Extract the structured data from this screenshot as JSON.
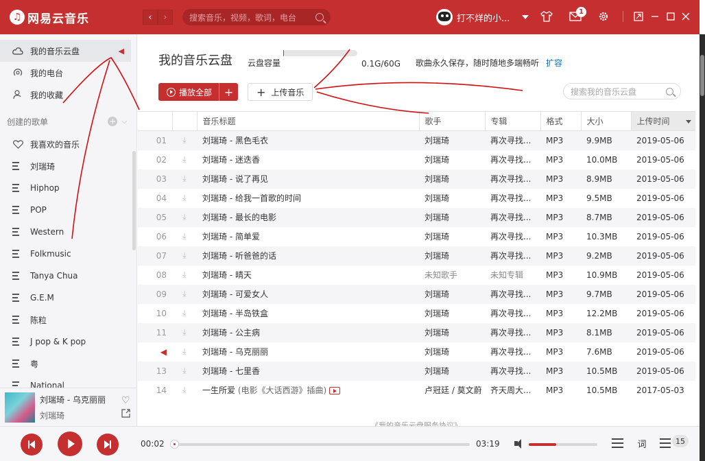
{
  "app": {
    "brand": "网易云音乐",
    "search_placeholder": "搜索音乐，视频，歌词，电台",
    "username": "打不烊的小...",
    "message_count": "1"
  },
  "sidebar": {
    "items": [
      {
        "label": "我的音乐云盘",
        "icon": "cloud-icon",
        "active": true
      },
      {
        "label": "我的电台",
        "icon": "radio-icon"
      },
      {
        "label": "我的收藏",
        "icon": "collection-icon"
      }
    ],
    "created_section": "创建的歌单",
    "playlists": [
      {
        "label": "我喜欢的音乐",
        "icon": "heart-icon"
      },
      {
        "label": "刘瑞琦",
        "icon": "playlist-icon"
      },
      {
        "label": "Hiphop",
        "icon": "playlist-icon"
      },
      {
        "label": "POP",
        "icon": "playlist-icon"
      },
      {
        "label": "Western",
        "icon": "playlist-icon"
      },
      {
        "label": "Folkmusic",
        "icon": "playlist-icon"
      },
      {
        "label": "Tanya Chua",
        "icon": "playlist-icon"
      },
      {
        "label": "G.E.M",
        "icon": "playlist-icon"
      },
      {
        "label": "陈粒",
        "icon": "playlist-icon"
      },
      {
        "label": "J pop & K pop",
        "icon": "playlist-icon"
      },
      {
        "label": "粤",
        "icon": "playlist-icon"
      },
      {
        "label": "National",
        "icon": "playlist-icon"
      }
    ]
  },
  "now_playing": {
    "title": "刘瑞琦 - 乌克丽丽",
    "artist": "刘瑞琦"
  },
  "cloud": {
    "title": "我的音乐云盘",
    "capacity_label": "云盘容量",
    "capacity_value": "0.1G/60G",
    "capacity_fraction": 0.002,
    "note": "歌曲永久保存，随时随地多端畅听",
    "expand_link": "扩容",
    "play_all": "播放全部",
    "upload": "上传音乐",
    "search_placeholder": "搜索我的音乐云盘",
    "footnote": "《我的音乐云盘服务协议》"
  },
  "table": {
    "columns": [
      "音乐标题",
      "歌手",
      "专辑",
      "格式",
      "大小",
      "上传时间"
    ],
    "rows": [
      {
        "idx": "01",
        "title": "刘瑞琦 - 黑色毛衣",
        "artist": "刘瑞琦",
        "album": "再次寻找...",
        "format": "MP3",
        "size": "9.9MB",
        "date": "2019-05-06"
      },
      {
        "idx": "02",
        "title": "刘瑞琦 - 迷迭香",
        "artist": "刘瑞琦",
        "album": "再次寻找...",
        "format": "MP3",
        "size": "10.0MB",
        "date": "2019-05-06"
      },
      {
        "idx": "03",
        "title": "刘瑞琦 - 说了再见",
        "artist": "刘瑞琦",
        "album": "再次寻找...",
        "format": "MP3",
        "size": "8.9MB",
        "date": "2019-05-06"
      },
      {
        "idx": "04",
        "title": "刘瑞琦 - 给我一首歌的时间",
        "artist": "刘瑞琦",
        "album": "再次寻找...",
        "format": "MP3",
        "size": "9.5MB",
        "date": "2019-05-06"
      },
      {
        "idx": "05",
        "title": "刘瑞琦 - 最长的电影",
        "artist": "刘瑞琦",
        "album": "再次寻找...",
        "format": "MP3",
        "size": "8.7MB",
        "date": "2019-05-06"
      },
      {
        "idx": "06",
        "title": "刘瑞琦 - 简单爱",
        "artist": "刘瑞琦",
        "album": "再次寻找...",
        "format": "MP3",
        "size": "10.3MB",
        "date": "2019-05-06"
      },
      {
        "idx": "07",
        "title": "刘瑞琦 - 听爸爸的话",
        "artist": "刘瑞琦",
        "album": "再次寻找...",
        "format": "MP3",
        "size": "9.2MB",
        "date": "2019-05-06"
      },
      {
        "idx": "08",
        "title": "刘瑞琦 - 晴天",
        "artist": "未知歌手",
        "album": "未知专辑",
        "format": "MP3",
        "size": "10.9MB",
        "date": "2019-05-06",
        "unknown": true
      },
      {
        "idx": "09",
        "title": "刘瑞琦 - 可爱女人",
        "artist": "刘瑞琦",
        "album": "再次寻找...",
        "format": "MP3",
        "size": "9.7MB",
        "date": "2019-05-06"
      },
      {
        "idx": "10",
        "title": "刘瑞琦 - 半岛铁盒",
        "artist": "刘瑞琦",
        "album": "再次寻找...",
        "format": "MP3",
        "size": "12.2MB",
        "date": "2019-05-06"
      },
      {
        "idx": "11",
        "title": "刘瑞琦 - 公主病",
        "artist": "刘瑞琦",
        "album": "再次寻找...",
        "format": "MP3",
        "size": "8.1MB",
        "date": "2019-05-06"
      },
      {
        "idx": "",
        "title": "刘瑞琦 - 乌克丽丽",
        "artist": "刘瑞琦",
        "album": "再次寻找...",
        "format": "MP3",
        "size": "7.6MB",
        "date": "2019-05-06",
        "playing": true
      },
      {
        "idx": "13",
        "title": "刘瑞琦 - 七里香",
        "artist": "刘瑞琦",
        "album": "再次寻找...",
        "format": "MP3",
        "size": "10.5MB",
        "date": "2019-05-06"
      },
      {
        "idx": "14",
        "title": "一生所爱",
        "subtitle": "(电影《大话西游》插曲)",
        "artist": "卢冠廷 / 莫文蔚",
        "album": "齐天周大...",
        "format": "MP3",
        "size": "10.5MB",
        "date": "2017-05-03",
        "mv": true
      }
    ]
  },
  "player": {
    "current_time": "00:02",
    "total_time": "03:19",
    "progress_fraction": 0.01,
    "volume_fraction": 0.4,
    "lyric_label": "词",
    "playlist_count": "15"
  },
  "colors": {
    "brand_red": "#c62f2f",
    "link_blue": "#0c73c2"
  }
}
